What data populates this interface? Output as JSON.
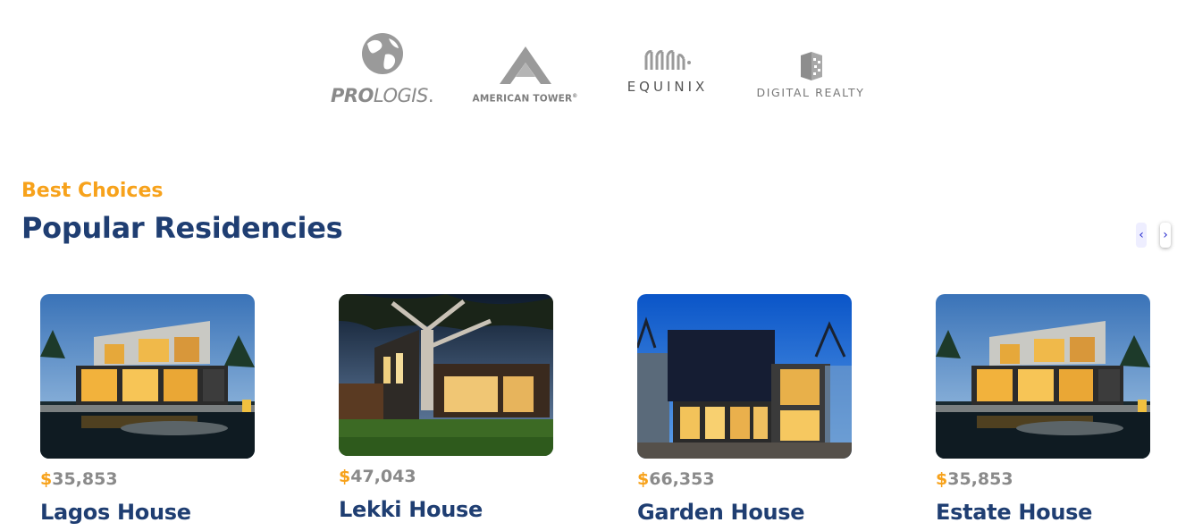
{
  "partners": [
    {
      "name": "PROLOGIS",
      "bold": "PRO",
      "light": "LOGIS",
      "reg": "."
    },
    {
      "name": "AMERICAN TOWER",
      "reg": "®"
    },
    {
      "name": "EQUINIX"
    },
    {
      "name": "DIGITAL REALTY"
    }
  ],
  "section": {
    "eyebrow": "Best Choices",
    "title": "Popular Residencies",
    "prev_icon": "‹",
    "next_icon": "›"
  },
  "colors": {
    "accent": "#f7a21b",
    "title": "#1f3e72",
    "price": "#8a8a8a",
    "nav": "#2a2fcf"
  },
  "residencies": [
    {
      "currency": "$",
      "price": "35,853",
      "name": "Lagos House",
      "image": "modern-house-pool-dusk"
    },
    {
      "currency": "$",
      "price": "47,043",
      "name": "Lekki House",
      "image": "modern-house-tree-lawn"
    },
    {
      "currency": "$",
      "price": "66,353",
      "name": "Garden House",
      "image": "glass-house-night"
    },
    {
      "currency": "$",
      "price": "35,853",
      "name": "Estate House",
      "image": "modern-house-pool-dusk"
    }
  ]
}
